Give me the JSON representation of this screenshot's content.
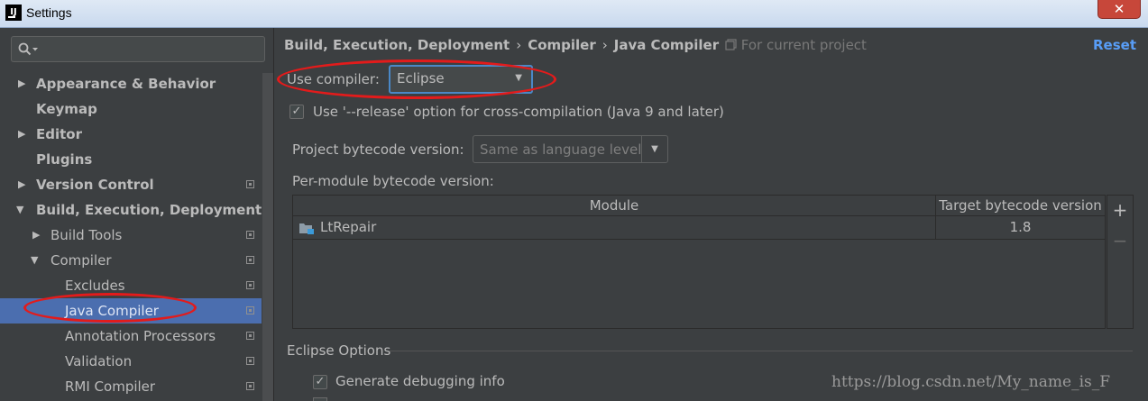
{
  "window": {
    "title": "Settings",
    "close_glyph": "✕",
    "app_icon_text": "IJ"
  },
  "sidebar": {
    "search_placeholder": "",
    "items": [
      {
        "label": "Appearance & Behavior",
        "arrow": "▶"
      },
      {
        "label": "Keymap"
      },
      {
        "label": "Editor",
        "arrow": "▶"
      },
      {
        "label": "Plugins"
      },
      {
        "label": "Version Control",
        "arrow": "▶"
      },
      {
        "label": "Build, Execution, Deployment",
        "arrow": "▼"
      },
      {
        "label": "Build Tools",
        "arrow": "▶"
      },
      {
        "label": "Compiler",
        "arrow": "▼"
      },
      {
        "label": "Excludes"
      },
      {
        "label": "Java Compiler",
        "selected": true
      },
      {
        "label": "Annotation Processors"
      },
      {
        "label": "Validation"
      },
      {
        "label": "RMI Compiler"
      }
    ]
  },
  "header": {
    "breadcrumb": [
      "Build, Execution, Deployment",
      "Compiler",
      "Java Compiler"
    ],
    "separator": "›",
    "for_project": "For current project",
    "reset": "Reset"
  },
  "form": {
    "use_compiler_label": "Use compiler:",
    "use_compiler_value": "Eclipse",
    "release_option_label": "Use '--release' option for cross-compilation (Java 9 and later)",
    "release_option_checked": true,
    "bytecode_label": "Project bytecode version:",
    "bytecode_value": "Same as language level",
    "per_module_label": "Per-module bytecode version:"
  },
  "table": {
    "columns": [
      "Module",
      "Target bytecode version"
    ],
    "rows": [
      {
        "module": "LtRepair",
        "target": "1.8"
      }
    ],
    "add": "+",
    "remove": "−"
  },
  "eclipse_options": {
    "title": "Eclipse Options",
    "generate_debug_label": "Generate debugging info",
    "generate_debug_checked": true
  },
  "watermark": "https://blog.csdn.net/My_name_is_F",
  "colors": {
    "accent": "#4b6eaf",
    "link": "#589df6",
    "annotation": "#e31b1b",
    "background": "#3c3f41"
  }
}
